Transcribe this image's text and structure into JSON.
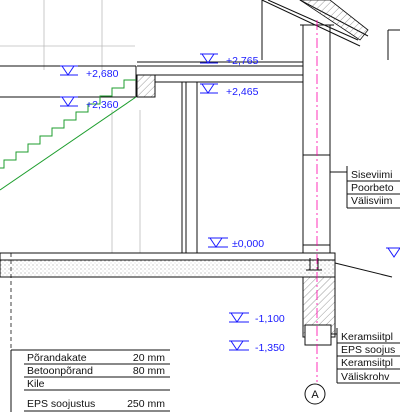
{
  "levels": {
    "l1": "+2,680",
    "l2": "+2,360",
    "l3": "+2,765",
    "l4": "+2,465",
    "l5": "±0,000",
    "l6": "-1,100",
    "l7": "-1,350"
  },
  "right_labels_top": [
    "Siseviimi",
    "Poorbeto",
    "Välisviim"
  ],
  "right_labels_bottom": [
    "Keramsiitpl",
    "EPS soojus",
    "Keramsiitpl",
    "Väliskrohv"
  ],
  "floor_layers": [
    {
      "name": "Põrandakate",
      "value": "20 mm"
    },
    {
      "name": "Betoonpõrand",
      "value": "80 mm"
    },
    {
      "name": "Kile",
      "value": ""
    },
    {
      "name": "EPS soojustus",
      "value": "250 mm"
    }
  ],
  "axis_label": "A",
  "colors": {
    "level": "#1a1aff",
    "stair": "#1e9e2e",
    "axis": "#ff00aa",
    "line": "#111111"
  }
}
